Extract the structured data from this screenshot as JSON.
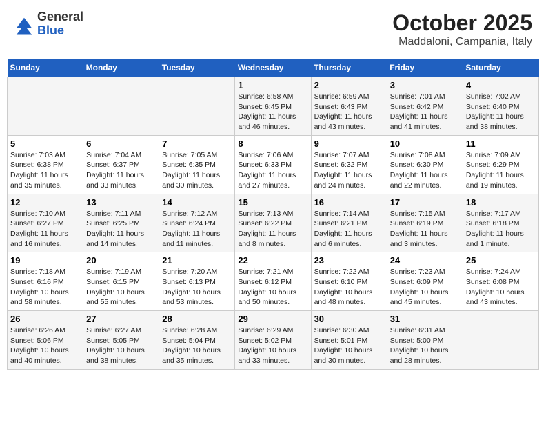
{
  "header": {
    "logo_general": "General",
    "logo_blue": "Blue",
    "title": "October 2025",
    "subtitle": "Maddaloni, Campania, Italy"
  },
  "weekdays": [
    "Sunday",
    "Monday",
    "Tuesday",
    "Wednesday",
    "Thursday",
    "Friday",
    "Saturday"
  ],
  "weeks": [
    [
      {
        "day": "",
        "info": ""
      },
      {
        "day": "",
        "info": ""
      },
      {
        "day": "",
        "info": ""
      },
      {
        "day": "1",
        "info": "Sunrise: 6:58 AM\nSunset: 6:45 PM\nDaylight: 11 hours and 46 minutes."
      },
      {
        "day": "2",
        "info": "Sunrise: 6:59 AM\nSunset: 6:43 PM\nDaylight: 11 hours and 43 minutes."
      },
      {
        "day": "3",
        "info": "Sunrise: 7:01 AM\nSunset: 6:42 PM\nDaylight: 11 hours and 41 minutes."
      },
      {
        "day": "4",
        "info": "Sunrise: 7:02 AM\nSunset: 6:40 PM\nDaylight: 11 hours and 38 minutes."
      }
    ],
    [
      {
        "day": "5",
        "info": "Sunrise: 7:03 AM\nSunset: 6:38 PM\nDaylight: 11 hours and 35 minutes."
      },
      {
        "day": "6",
        "info": "Sunrise: 7:04 AM\nSunset: 6:37 PM\nDaylight: 11 hours and 33 minutes."
      },
      {
        "day": "7",
        "info": "Sunrise: 7:05 AM\nSunset: 6:35 PM\nDaylight: 11 hours and 30 minutes."
      },
      {
        "day": "8",
        "info": "Sunrise: 7:06 AM\nSunset: 6:33 PM\nDaylight: 11 hours and 27 minutes."
      },
      {
        "day": "9",
        "info": "Sunrise: 7:07 AM\nSunset: 6:32 PM\nDaylight: 11 hours and 24 minutes."
      },
      {
        "day": "10",
        "info": "Sunrise: 7:08 AM\nSunset: 6:30 PM\nDaylight: 11 hours and 22 minutes."
      },
      {
        "day": "11",
        "info": "Sunrise: 7:09 AM\nSunset: 6:29 PM\nDaylight: 11 hours and 19 minutes."
      }
    ],
    [
      {
        "day": "12",
        "info": "Sunrise: 7:10 AM\nSunset: 6:27 PM\nDaylight: 11 hours and 16 minutes."
      },
      {
        "day": "13",
        "info": "Sunrise: 7:11 AM\nSunset: 6:25 PM\nDaylight: 11 hours and 14 minutes."
      },
      {
        "day": "14",
        "info": "Sunrise: 7:12 AM\nSunset: 6:24 PM\nDaylight: 11 hours and 11 minutes."
      },
      {
        "day": "15",
        "info": "Sunrise: 7:13 AM\nSunset: 6:22 PM\nDaylight: 11 hours and 8 minutes."
      },
      {
        "day": "16",
        "info": "Sunrise: 7:14 AM\nSunset: 6:21 PM\nDaylight: 11 hours and 6 minutes."
      },
      {
        "day": "17",
        "info": "Sunrise: 7:15 AM\nSunset: 6:19 PM\nDaylight: 11 hours and 3 minutes."
      },
      {
        "day": "18",
        "info": "Sunrise: 7:17 AM\nSunset: 6:18 PM\nDaylight: 11 hours and 1 minute."
      }
    ],
    [
      {
        "day": "19",
        "info": "Sunrise: 7:18 AM\nSunset: 6:16 PM\nDaylight: 10 hours and 58 minutes."
      },
      {
        "day": "20",
        "info": "Sunrise: 7:19 AM\nSunset: 6:15 PM\nDaylight: 10 hours and 55 minutes."
      },
      {
        "day": "21",
        "info": "Sunrise: 7:20 AM\nSunset: 6:13 PM\nDaylight: 10 hours and 53 minutes."
      },
      {
        "day": "22",
        "info": "Sunrise: 7:21 AM\nSunset: 6:12 PM\nDaylight: 10 hours and 50 minutes."
      },
      {
        "day": "23",
        "info": "Sunrise: 7:22 AM\nSunset: 6:10 PM\nDaylight: 10 hours and 48 minutes."
      },
      {
        "day": "24",
        "info": "Sunrise: 7:23 AM\nSunset: 6:09 PM\nDaylight: 10 hours and 45 minutes."
      },
      {
        "day": "25",
        "info": "Sunrise: 7:24 AM\nSunset: 6:08 PM\nDaylight: 10 hours and 43 minutes."
      }
    ],
    [
      {
        "day": "26",
        "info": "Sunrise: 6:26 AM\nSunset: 5:06 PM\nDaylight: 10 hours and 40 minutes."
      },
      {
        "day": "27",
        "info": "Sunrise: 6:27 AM\nSunset: 5:05 PM\nDaylight: 10 hours and 38 minutes."
      },
      {
        "day": "28",
        "info": "Sunrise: 6:28 AM\nSunset: 5:04 PM\nDaylight: 10 hours and 35 minutes."
      },
      {
        "day": "29",
        "info": "Sunrise: 6:29 AM\nSunset: 5:02 PM\nDaylight: 10 hours and 33 minutes."
      },
      {
        "day": "30",
        "info": "Sunrise: 6:30 AM\nSunset: 5:01 PM\nDaylight: 10 hours and 30 minutes."
      },
      {
        "day": "31",
        "info": "Sunrise: 6:31 AM\nSunset: 5:00 PM\nDaylight: 10 hours and 28 minutes."
      },
      {
        "day": "",
        "info": ""
      }
    ]
  ]
}
